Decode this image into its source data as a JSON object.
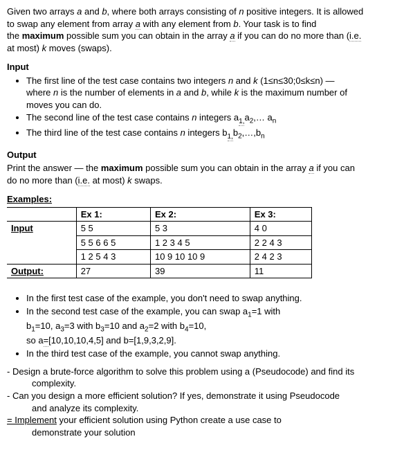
{
  "intro": {
    "l1_pre": "Given two arrays ",
    "a": "a",
    "l1_mid1": " and ",
    "b": "b",
    "l1_mid2": ", where both arrays consisting of ",
    "n": "n",
    "l1_post": " positive integers. It is allowed",
    "l2_pre": "to swap any element from array ",
    "l2_mid1": " with any element from ",
    "l2_post": ". Your task is to find",
    "l3_pre": "the ",
    "max": "maximum",
    "l3_mid1": " possible sum you can obtain in the array ",
    "l3_mid2": " if you can do no more than (",
    "ie": "i.e.",
    "l4_pre": "at most) ",
    "k": "k",
    "l4_post": " moves (swaps)."
  },
  "input": {
    "heading": "Input",
    "b1_pre": "The first line of the test case contains two integers ",
    "b1_mid1": " and ",
    "b1_cond": " (1≤n≤30;0≤k≤n) —",
    "b1_l2_pre": "where ",
    "b1_l2_mid1": " is the number of elements in ",
    "b1_l2_mid2": " and ",
    "b1_l2_mid3": ", while ",
    "b1_l2_post": " is the maximum number of",
    "b1_l3": "moves you can do.",
    "b2_pre": "The second line of the test case contains ",
    "b2_mid": " integers a",
    "b2_sub1": "1,",
    "b2_mid2": "a",
    "b2_sub2": "2",
    "b2_post": ",… a",
    "b2_subn": "n",
    "b3_pre": "The third line of the test case contains ",
    "b3_mid": " integers b",
    "b3_sub1": "1,",
    "b3_mid2": "b",
    "b3_sub2": "2",
    "b3_post": ",…,b",
    "b3_subn": "n"
  },
  "output": {
    "heading": "Output",
    "l1_pre": "Print the answer — the ",
    "l1_mid1": " possible sum you can obtain in the array ",
    "l1_post": " if you can",
    "l2_pre": "do no more than (",
    "l2_mid": " at most) ",
    "l2_post": " swaps."
  },
  "examples": {
    "heading": "Examples:",
    "row_input": "Input",
    "row_output": "Output:",
    "cols": [
      "Ex 1:",
      "Ex 2:",
      "Ex 3:"
    ],
    "in_r1": [
      "5 5",
      "5 3",
      "4 0"
    ],
    "in_r2": [
      "5 5 6 6 5",
      "1 2 3 4 5",
      "2 2 4 3"
    ],
    "in_r3": [
      "1 2 5 4 3",
      "10 9 10 10 9",
      "2 4 2 3"
    ],
    "out": [
      "27",
      "39",
      "11"
    ]
  },
  "explain": {
    "b1": "In the first test case of the example, you don't need to swap anything.",
    "b2_l1": "In the second test case of the example, you can swap a",
    "b2_sub1": "1",
    "b2_l1b": "=1 with",
    "b2_l2a": "b",
    "b2_l2as": "1",
    "b2_l2b": "=10, a",
    "b2_l2bs": "3",
    "b2_l2c": "=3 with b",
    "b2_l2cs": "3",
    "b2_l2d": "=10 and a",
    "b2_l2ds": "2",
    "b2_l2e": "=2 with b",
    "b2_l2es": "4",
    "b2_l2f": "=10,",
    "b2_l3a": "so a",
    "b2_l3eq": "=",
    "b2_l3b": "[10,10,10,4,5] and  b=[1,9,3,2,9].",
    "b3": "In the third test case of the example, you cannot swap anything."
  },
  "tasks": {
    "t1a": "-   Design a brute-force algorithm to solve this problem using a (Pseudocode) and find its",
    "t1b": "complexity.",
    "t2a": "-   Can you design a more efficient solution? If yes, demonstrate it using Pseudocode",
    "t2b": "and analyze its complexity.",
    "t3a_pre": "=  Implement",
    "t3a_post": " your efficient solution using Python  create a use case to",
    "t3b": "demonstrate your solution"
  }
}
